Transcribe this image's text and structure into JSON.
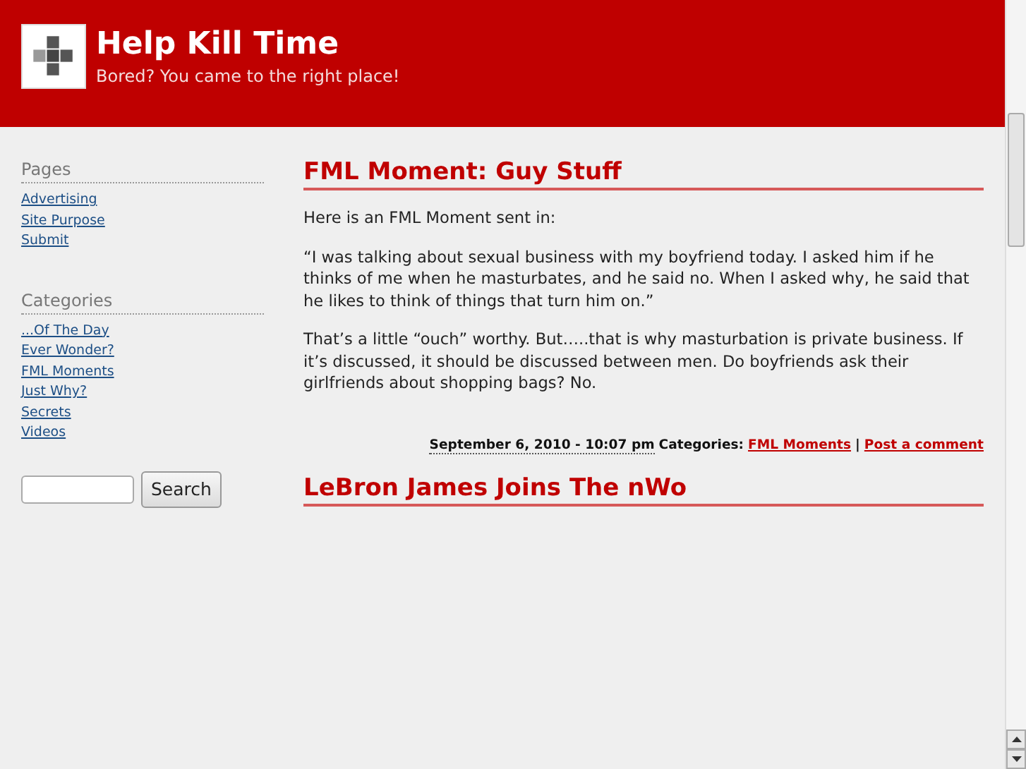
{
  "header": {
    "title": "Help Kill Time",
    "tagline": "Bored? You came to the right place!"
  },
  "sidebar": {
    "sections": [
      {
        "title": "Pages",
        "links": [
          "Advertising",
          "Site Purpose",
          "Submit"
        ]
      },
      {
        "title": "Categories",
        "links": [
          "...Of The Day",
          "Ever Wonder?",
          "FML Moments",
          "Just Why?",
          "Secrets",
          "Videos"
        ]
      }
    ],
    "search": {
      "button": "Search"
    }
  },
  "posts": [
    {
      "title": "FML Moment: Guy Stuff",
      "paragraphs": [
        "Here is an FML Moment sent in:",
        "“I was talking about sexual business with my boyfriend today. I asked him if he thinks of me when he masturbates, and he said no. When I asked why, he said that he likes to think of things that turn him on.”",
        "That’s a little “ouch” worthy. But…..that is why masturbation is private business. If it’s discussed, it should be discussed between men. Do boyfriends ask their girlfriends about shopping bags? No."
      ],
      "meta": {
        "date": "September 6, 2010 - 10:07 pm",
        "categories_label": "Categories:",
        "category": "FML Moments",
        "separator": "|",
        "comment_link": "Post a comment"
      }
    },
    {
      "title": "LeBron James Joins The nWo"
    }
  ]
}
